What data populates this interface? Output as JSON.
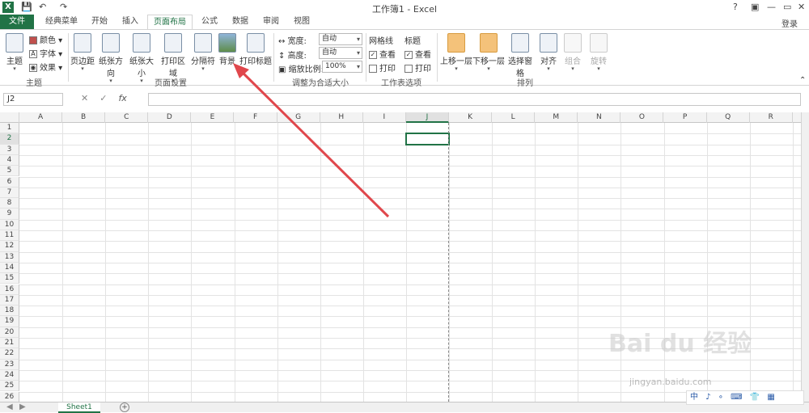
{
  "window": {
    "title": "工作簿1 - Excel",
    "help": "?",
    "login": "登录"
  },
  "tabs": [
    "文件",
    "经典菜单",
    "开始",
    "插入",
    "页面布局",
    "公式",
    "数据",
    "审阅",
    "视图"
  ],
  "ribbon": {
    "theme": {
      "main": "主题",
      "colors": "颜色",
      "fonts": "字体",
      "effects": "效果",
      "group": "主题"
    },
    "page_setup": {
      "margins": "页边距",
      "orientation": "纸张方向",
      "size": "纸张大小",
      "print_area": "打印区域",
      "breaks": "分隔符",
      "background": "背景",
      "print_titles": "打印标题",
      "group": "页面设置"
    },
    "scale": {
      "width_label": "宽度:",
      "width_value": "自动",
      "height_label": "高度:",
      "height_value": "自动",
      "scale_label": "缩放比例:",
      "scale_value": "100%",
      "group": "调整为合适大小"
    },
    "sheet_options": {
      "gridlines": "网格线",
      "headings": "标题",
      "view": "查看",
      "print": "打印",
      "group": "工作表选项"
    },
    "arrange": {
      "forward": "上移一层",
      "backward": "下移一层",
      "selection_pane": "选择窗格",
      "align": "对齐",
      "group_btn": "组合",
      "rotate": "旋转",
      "group": "排列"
    }
  },
  "formula_bar": {
    "name_box": "J2",
    "fx": "fx",
    "cancel": "✕",
    "enter": "✓"
  },
  "columns": [
    "A",
    "B",
    "C",
    "D",
    "E",
    "F",
    "G",
    "H",
    "I",
    "J",
    "K",
    "L",
    "M",
    "N",
    "O",
    "P",
    "Q",
    "R"
  ],
  "rows": [
    "1",
    "2",
    "3",
    "4",
    "5",
    "6",
    "7",
    "8",
    "9",
    "10",
    "11",
    "12",
    "13",
    "14",
    "15",
    "16",
    "17",
    "18",
    "19",
    "20",
    "21",
    "22",
    "23",
    "24",
    "25",
    "26"
  ],
  "selected": {
    "column": "J",
    "row": "2"
  },
  "sheet": {
    "name": "Sheet1",
    "add": "+"
  },
  "watermark": {
    "logo": "Bai du 经验",
    "url": "jingyan.baidu.com"
  },
  "ime": "中 ♪ ∘ ⌨ 👕 ▦",
  "colors": {
    "excel_green": "#217346",
    "arrow": "#e0474c"
  }
}
